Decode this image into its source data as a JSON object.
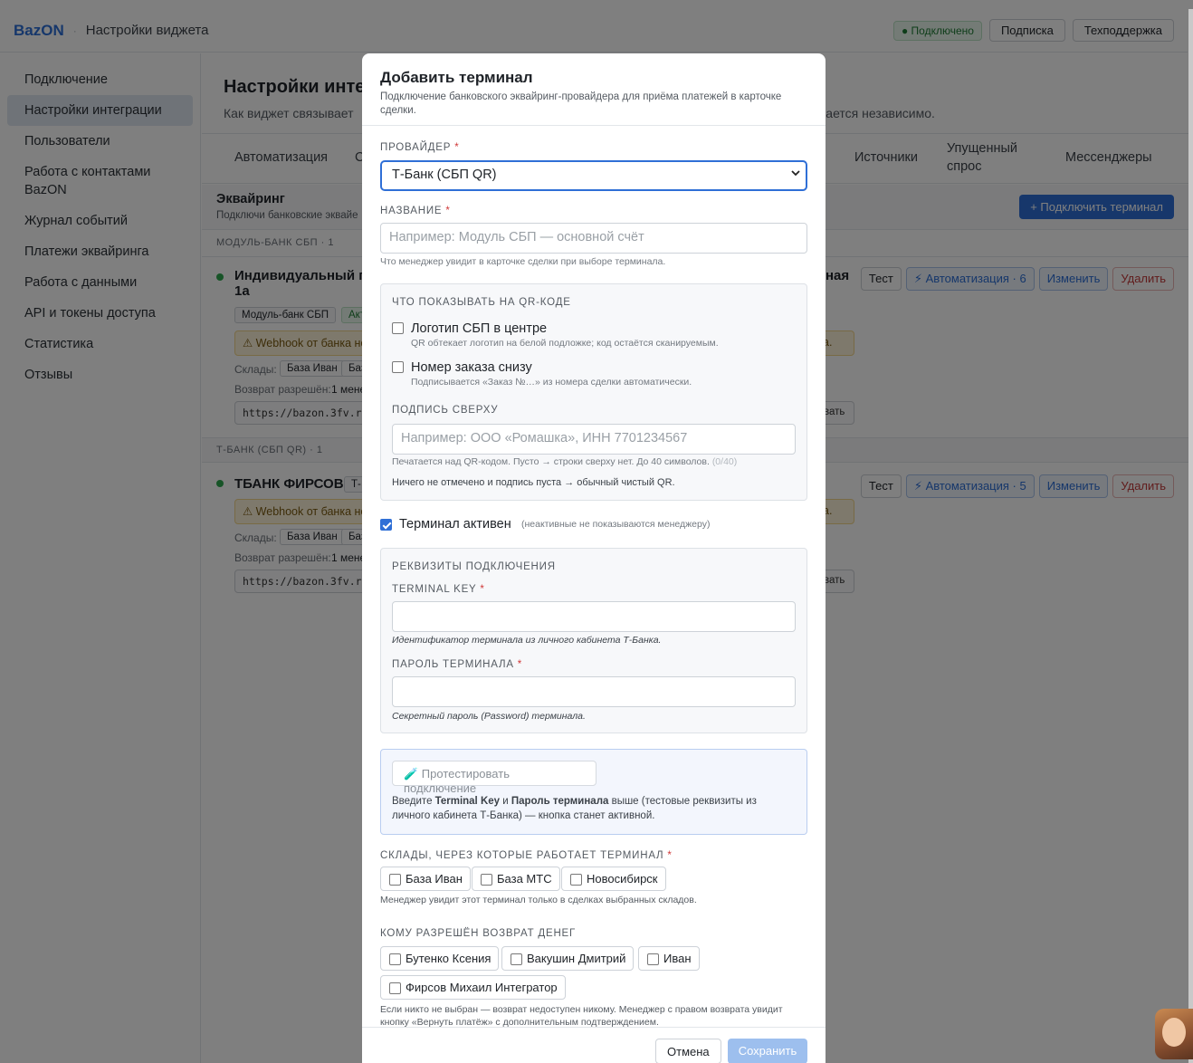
{
  "app": {
    "brand": "BazON",
    "breadcrumb": "Настройки виджета",
    "status": "● Подключено",
    "buttons": {
      "subscription": "Подписка",
      "support": "Техподдержка"
    }
  },
  "sidebar": {
    "items": [
      {
        "label": "Подключение"
      },
      {
        "label": "Настройки интеграции",
        "active": true
      },
      {
        "label": "Пользователи"
      },
      {
        "label": "Работа с контактами BazON"
      },
      {
        "label": "Журнал событий"
      },
      {
        "label": "Платежи эквайринга"
      },
      {
        "label": "Работа с данными"
      },
      {
        "label": "API и токены доступа"
      },
      {
        "label": "Статистика"
      },
      {
        "label": "Отзывы"
      }
    ]
  },
  "page": {
    "title": "Настройки инте",
    "subtitle_left": "Как виджет связывает",
    "subtitle_right": "вается независимо.",
    "tabs": [
      "Автоматизация",
      "С",
      "Источники",
      "Упущенный спрос",
      "Мессенджеры"
    ],
    "section_title": "Эквайринг",
    "section_sub": "Подключи банковские эквайе",
    "connect_button": "+ Подключить терминал",
    "groups": [
      {
        "label": "МОДУЛЬ-БАНК СБП · 1",
        "title": "Индивидуальный пр",
        "title_line2": "1а",
        "title_right": "ная",
        "chips": [
          "Модуль-банк СБП",
          "Акт"
        ],
        "warning": "⚠ Webhook от банка не",
        "warning_right": "а.",
        "stores_label": "Склады:",
        "stores": [
          "База Иван",
          "Баз"
        ],
        "refund_label": "Возврат разрешён:",
        "refund_value": "1 мене",
        "url": "https://bazon.3fv.ru/v",
        "copy_right": "вать",
        "actions": {
          "test": "Тест",
          "automation": "⚡ Автоматизация · 6",
          "edit": "Изменить",
          "delete": "Удалить"
        }
      },
      {
        "label": "Т-БАНК (СБП QR) · 1",
        "title": "ТБАНК ФИРСОВ",
        "chip": "Т-",
        "warning": "⚠ Webhook от банка не",
        "warning_right": "а.",
        "stores_label": "Склады:",
        "stores": [
          "База Иван",
          "Баз"
        ],
        "refund_label": "Возврат разрешён:",
        "refund_value": "1 мене",
        "url": "https://bazon.3fv.ru/v",
        "copy_right": "вать",
        "actions": {
          "test": "Тест",
          "automation": "⚡ Автоматизация · 5",
          "edit": "Изменить",
          "delete": "Удалить"
        }
      }
    ]
  },
  "modal": {
    "title": "Добавить терминал",
    "subtitle": "Подключение банковского эквайринг-провайдера для приёма платежей в карточке сделки.",
    "provider_label": "ПРОВАЙДЕР",
    "provider_value": "Т-Банк (СБП QR)",
    "name_label": "НАЗВАНИЕ",
    "name_placeholder": "Например: Модуль СБП — основной счёт",
    "name_hint": "Что менеджер увидит в карточке сделки при выборе терминала.",
    "qr": {
      "title": "ЧТО ПОКАЗЫВАТЬ НА QR-КОДЕ",
      "logo_label": "Логотип СБП в центре",
      "logo_hint": "QR обтекает логотип на белой подложке; код остаётся сканируемым.",
      "logo_checked": false,
      "order_label": "Номер заказа снизу",
      "order_hint": "Подписывается «Заказ №…» из номера сделки автоматически.",
      "order_checked": false,
      "caption_label": "ПОДПИСЬ СВЕРХУ",
      "caption_placeholder": "Например: ООО «Ромашка», ИНН 7701234567",
      "caption_hint": "Печатается над QR-кодом. Пусто → строки сверху нет. До 40 символов.",
      "caption_counter": "(0/40)",
      "note": "Ничего не отмечено и подпись пуста → обычный чистый QR."
    },
    "active": {
      "label": "Терминал активен",
      "hint": "(неактивные не показываются менеджеру)",
      "checked": true
    },
    "credentials": {
      "title": "РЕКВИЗИТЫ ПОДКЛЮЧЕНИЯ",
      "key_label": "TERMINAL KEY",
      "key_hint": "Идентификатор терминала из личного кабинета Т-Банка.",
      "password_label": "ПАРОЛЬ ТЕРМИНАЛА",
      "password_hint": "Секретный пароль (Password) терминала."
    },
    "test": {
      "button": "🧪 Протестировать подключение",
      "note_1": "Введите ",
      "note_b1": "Terminal Key",
      "note_2": " и ",
      "note_b2": "Пароль терминала",
      "note_3": " выше (тестовые реквизиты из личного кабинета Т-Банка) — кнопка станет активной."
    },
    "stores": {
      "label": "СКЛАДЫ, ЧЕРЕЗ КОТОРЫЕ РАБОТАЕТ ТЕРМИНАЛ",
      "options": [
        "База Иван",
        "База МТС",
        "Новосибирск"
      ],
      "hint": "Менеджер увидит этот терминал только в сделках выбранных складов."
    },
    "refunds": {
      "label": "КОМУ РАЗРЕШЁН ВОЗВРАТ ДЕНЕГ",
      "options": [
        "Бутенко Ксения",
        "Вакушин Дмитрий",
        "Иван",
        "Фирсов Михаил Интегратор"
      ],
      "hint": "Если никто не выбран — возврат недоступен никому. Менеджер с правом возврата увидит кнопку «Вернуть платёж» с дополнительным подтверждением."
    },
    "footer": {
      "cancel": "Отмена",
      "save": "Сохранить"
    }
  },
  "colors": {
    "accent": "#2f6fd6",
    "danger": "#d03838",
    "success": "#2fa84f",
    "warning_bg": "#fdf3d8"
  }
}
